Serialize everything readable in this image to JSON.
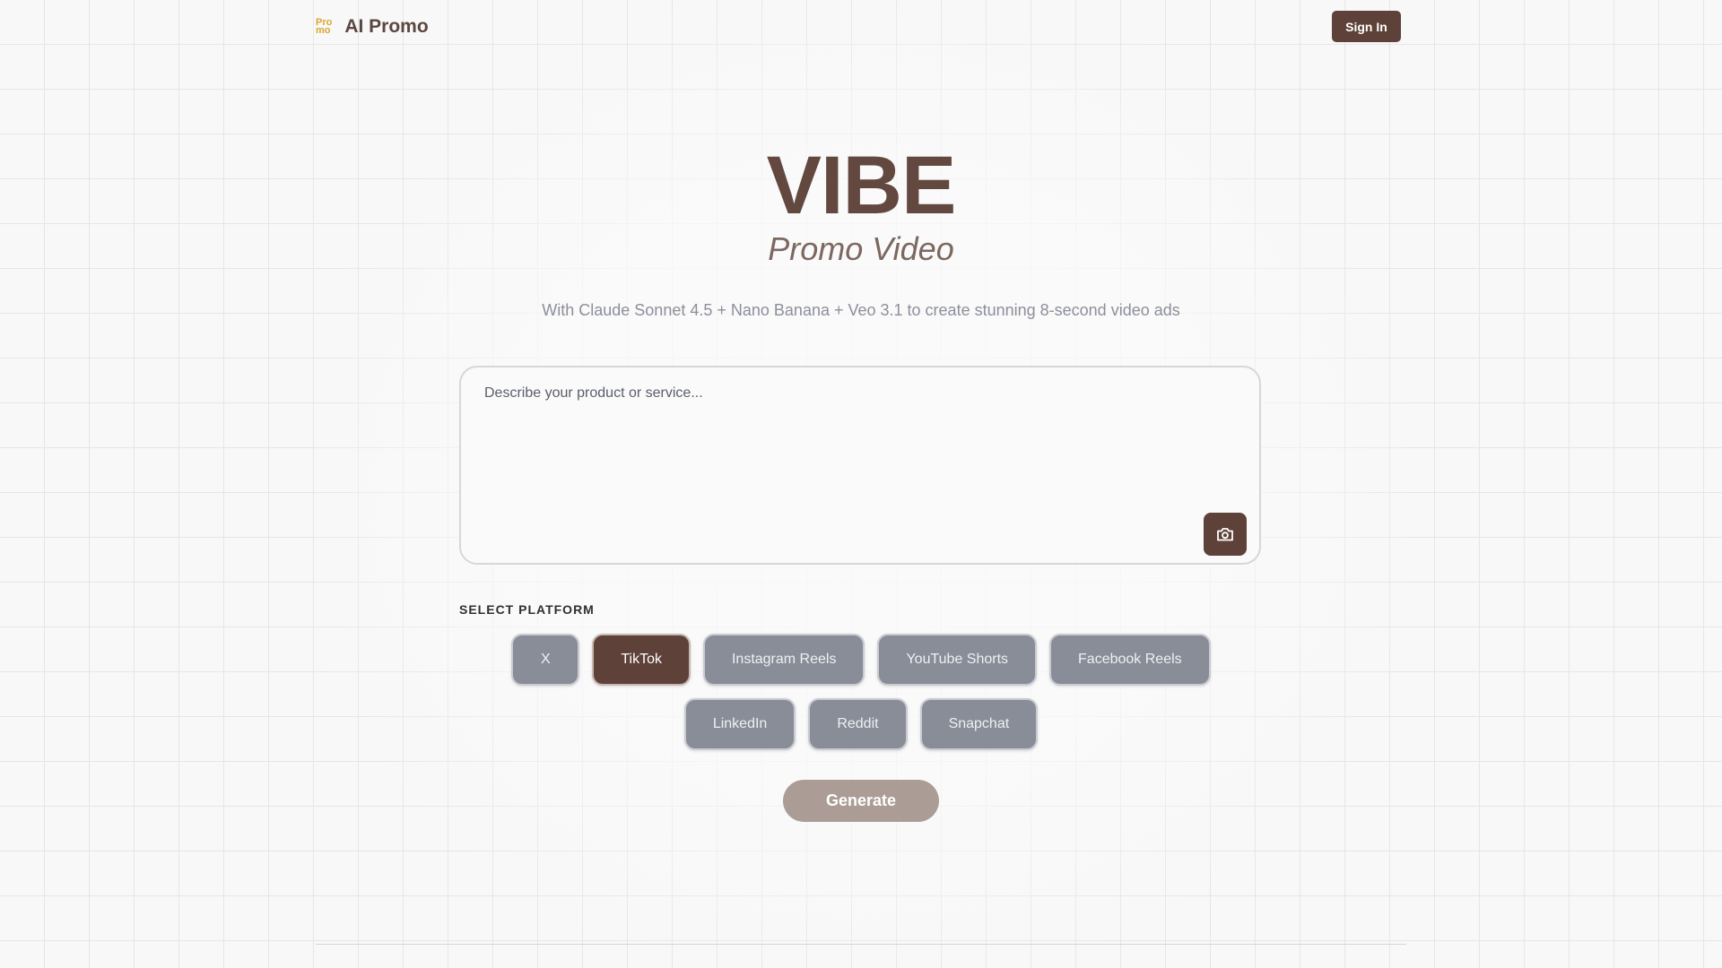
{
  "header": {
    "logo_mark_top": "Pro",
    "logo_mark_bottom": "mo",
    "logo_text": "AI Promo",
    "signin_label": "Sign In"
  },
  "hero": {
    "title": "VIBE",
    "subtitle": "Promo Video",
    "tagline": "With Claude Sonnet 4.5 + Nano Banana + Veo 3.1 to create stunning 8-second video ads"
  },
  "prompt": {
    "placeholder": "Describe your product or service...",
    "value": "",
    "upload_icon": "camera-icon"
  },
  "platforms": {
    "label": "SELECT PLATFORM",
    "selected": "TikTok",
    "row1": [
      "X",
      "TikTok",
      "Instagram Reels",
      "YouTube Shorts",
      "Facebook Reels"
    ],
    "row2": [
      "LinkedIn",
      "Reddit",
      "Snapchat"
    ]
  },
  "generate_label": "Generate",
  "colors": {
    "brand": "#5e4139",
    "logo_accent": "#d9a82f",
    "chip_inactive": "#898d98",
    "generate_disabled": "#ac9c96",
    "background": "#f8f8f8"
  }
}
